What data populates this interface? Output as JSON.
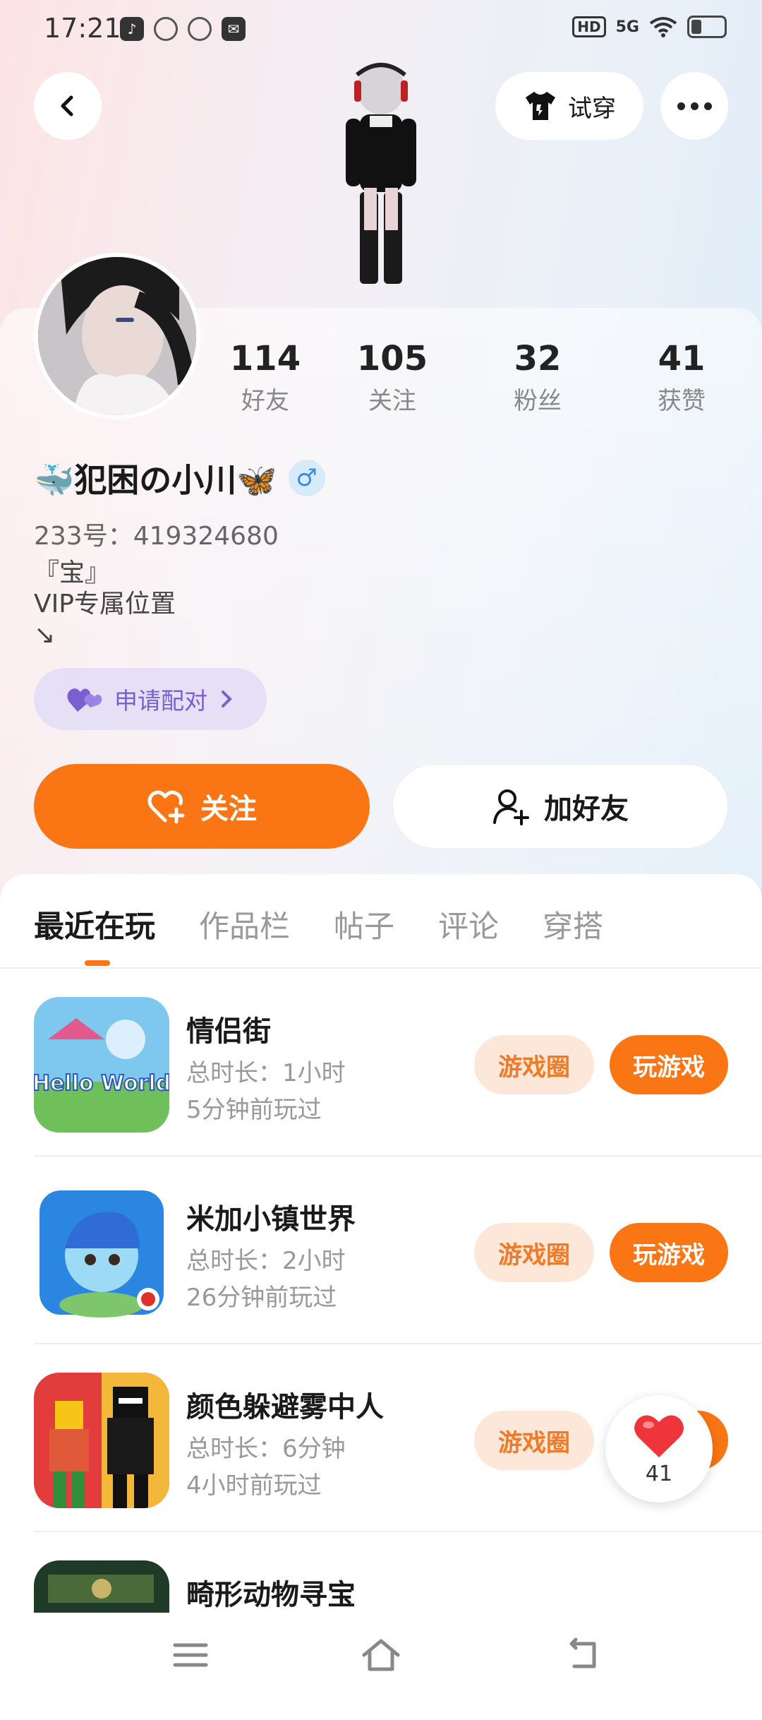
{
  "status_bar": {
    "time": "17:21",
    "hd": "HD",
    "network": "5G"
  },
  "header": {
    "tryon_label": "试穿"
  },
  "stats": [
    {
      "num": "114",
      "label": "好友"
    },
    {
      "num": "105",
      "label": "关注"
    },
    {
      "num": "32",
      "label": "粉丝"
    },
    {
      "num": "41",
      "label": "获赞"
    }
  ],
  "profile": {
    "nickname": "🐳犯困の小川🦋",
    "gender_symbol": "♂",
    "uid": "233号：419324680",
    "bio": "『宝』\nVIP专属位置\n↘",
    "pair_label": "申请配对"
  },
  "actions": {
    "follow_label": "关注",
    "add_friend_label": "加好友"
  },
  "tabs": [
    "最近在玩",
    "作品栏",
    "帖子",
    "评论",
    "穿搭"
  ],
  "games": [
    {
      "name": "情侣街",
      "duration": "总时长：1小时",
      "last_played": "5分钟前玩过",
      "circle_label": "游戏圈",
      "play_label": "玩游戏"
    },
    {
      "name": "米加小镇世界",
      "duration": "总时长：2小时",
      "last_played": "26分钟前玩过",
      "circle_label": "游戏圈",
      "play_label": "玩游戏"
    },
    {
      "name": "颜色躲避雾中人",
      "duration": "总时长：6分钟",
      "last_played": "4小时前玩过",
      "circle_label": "游戏圈",
      "play_label": "玩游戏"
    },
    {
      "name": "畸形动物寻宝",
      "duration": "",
      "last_played": "",
      "circle_label": "",
      "play_label": ""
    }
  ],
  "game_icon_text": {
    "hello_world": "Hello World"
  },
  "like_fab": {
    "count": "41"
  },
  "colors": {
    "accent": "#fa7514",
    "pair": "#7a5fd0",
    "circle_bg": "#fde7d9"
  }
}
